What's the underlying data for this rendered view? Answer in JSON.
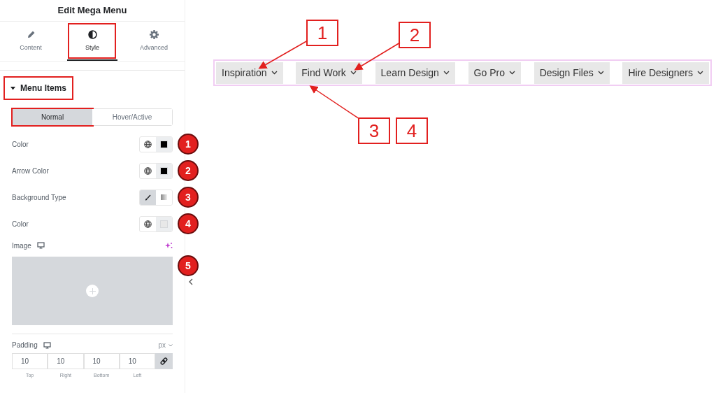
{
  "panel": {
    "title": "Edit Mega Menu",
    "tabs": [
      {
        "label": "Content",
        "kind": "pencil",
        "selected": false,
        "highlighted": false
      },
      {
        "label": "Style",
        "kind": "contrast",
        "selected": true,
        "highlighted": true
      },
      {
        "label": "Advanced",
        "kind": "gear",
        "selected": false,
        "highlighted": false
      }
    ],
    "section": {
      "title": "Menu Items",
      "expanded": true,
      "highlighted": true
    },
    "state_tabs": [
      {
        "label": "Normal",
        "selected": true,
        "highlighted": true
      },
      {
        "label": "Hover/Active",
        "selected": false,
        "highlighted": false
      }
    ],
    "controls": [
      {
        "kind": "color",
        "label": "Color",
        "color": "#000000",
        "badge": "1"
      },
      {
        "kind": "color",
        "label": "Arrow Color",
        "color": "#000000",
        "badge": "2"
      },
      {
        "kind": "bgtype",
        "label": "Background Type",
        "badge": "3"
      },
      {
        "kind": "color",
        "label": "Color",
        "color": "#e8e8e8",
        "badge": "4"
      }
    ],
    "image": {
      "label": "Image",
      "badge": "5"
    },
    "padding": {
      "label": "Padding",
      "unit": "px",
      "linked": true,
      "fields": [
        {
          "value": "10",
          "label": "Top"
        },
        {
          "value": "10",
          "label": "Right"
        },
        {
          "value": "10",
          "label": "Bottom"
        },
        {
          "value": "10",
          "label": "Left"
        }
      ]
    }
  },
  "menu": {
    "items": [
      "Inspiration",
      "Find Work",
      "Learn Design",
      "Go Pro",
      "Design Files",
      "Hire Designers"
    ]
  },
  "callouts": [
    {
      "label": "1"
    },
    {
      "label": "2"
    },
    {
      "label": "3"
    },
    {
      "label": "4"
    }
  ]
}
